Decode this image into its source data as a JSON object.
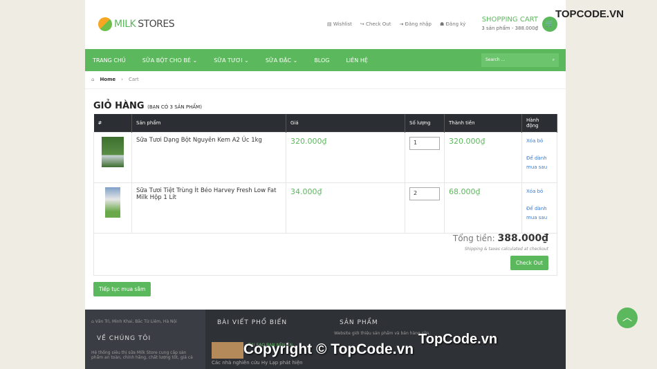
{
  "header": {
    "logo_a": "MILK",
    "logo_b": "STORES",
    "links": [
      "▤ Wishlist",
      "↪ Check Out",
      "⇥ Đăng nhập",
      "☗ Đăng ký"
    ],
    "cart_title": "SHOPPING CART",
    "cart_summary": "3 sản phẩm - 388.000₫"
  },
  "nav": {
    "items": [
      "TRANG CHỦ",
      "SỮA BỘT CHO BÉ ⌄",
      "SỮA TƯƠI ⌄",
      "SỮA ĐẶC ⌄",
      "BLOG",
      "LIÊN HỆ"
    ],
    "search_placeholder": "Search ..."
  },
  "breadcrumb": {
    "home": "Home",
    "sep": "›",
    "current": "Cart"
  },
  "cart": {
    "title": "GIỎ HÀNG",
    "subtitle": "(BẠN CÓ 3 SẢN PHẨM)",
    "columns": [
      "#",
      "Sản phẩm",
      "Giá",
      "Số lượng",
      "Thành tiền",
      "Hành động"
    ],
    "rows": [
      {
        "name": "Sữa Tươi Dạng Bột Nguyên Kem A2 Úc 1kg",
        "price": "320.000₫",
        "qty": "1",
        "total": "320.000₫",
        "remove": "Xóa bỏ",
        "save": "Để dành mua sau"
      },
      {
        "name": "Sữa Tươi Tiệt Trùng Ít Béo Harvey Fresh Low Fat Milk Hộp 1 Lít",
        "price": "34.000₫",
        "qty": "2",
        "total": "68.000₫",
        "remove": "Xóa bỏ",
        "save": "Để dành mua sau"
      }
    ],
    "total_label": "Tổng tiền:",
    "total": "388.000₫",
    "shipping_note": "Shipping & taxes calculated at checkout",
    "checkout": "Check Out",
    "continue": "Tiếp tục mua sắm"
  },
  "footer": {
    "address": "Văn Trì, Minh Khai, Bắc Từ Liêm, Hà Nội",
    "about_title": "VỀ CHÚNG TÔI",
    "about_text": "Hệ thống siêu thị sữa Milk Store cung cấp sản phẩm an toàn, chính hãng, chất lượng tốt, giá cả",
    "posts_title": "BÀI VIẾT PHỔ BIẾN",
    "post_title": "TẠI SAO BẠN NÊN ĂN",
    "post_text": "Các nhà nghiên cứu Hy Lạp phát hiện",
    "products_title": "SẢN PHẨM",
    "products_text": "Website giới thiệu sản phẩm và bán hàng sữa."
  },
  "watermark": {
    "logo": "TOPCODE.VN",
    "copyright": "Copyright © TopCode.vn",
    "brand": "TopCode.vn"
  },
  "colors": {
    "accent": "#5cb85c",
    "dark": "#2b2e33"
  }
}
